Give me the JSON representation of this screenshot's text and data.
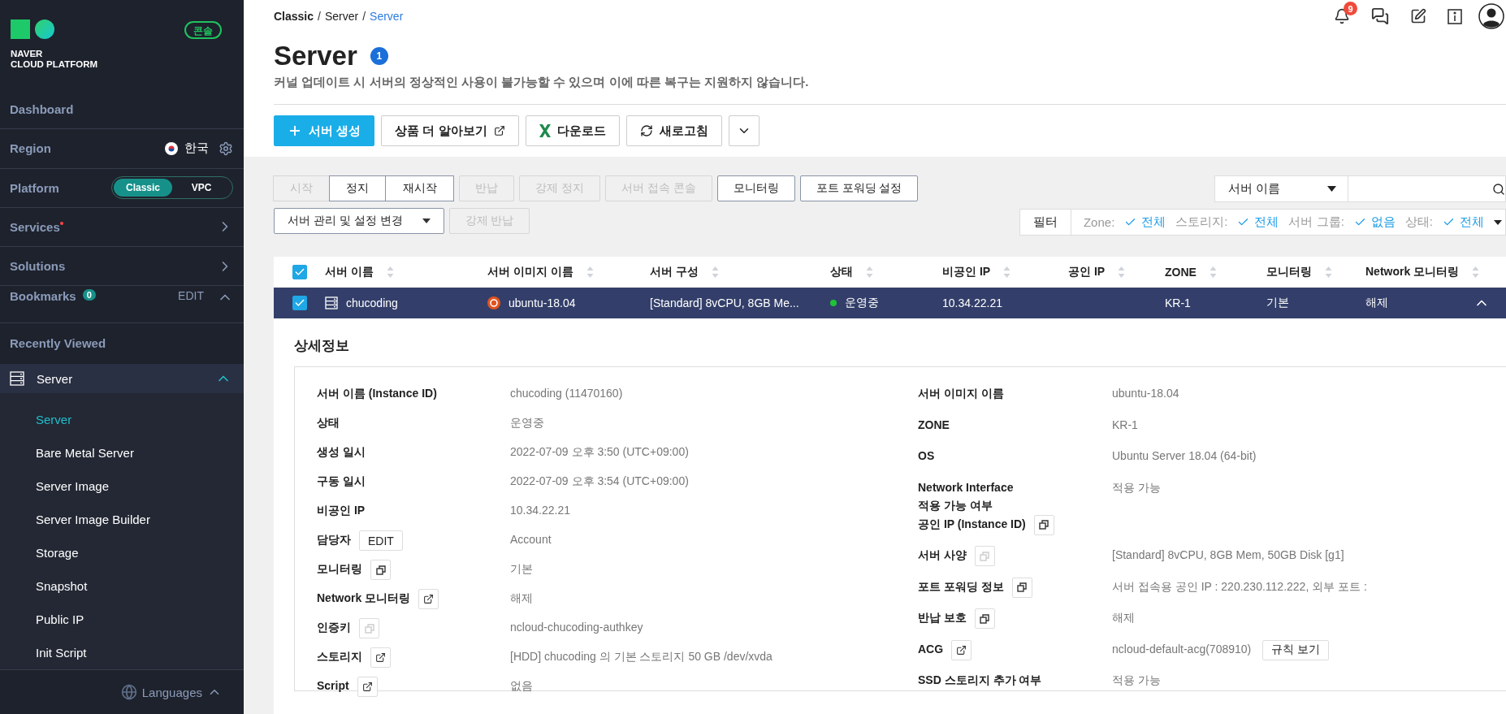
{
  "sidebar": {
    "logo": {
      "line1": "NAVER",
      "line2": "CLOUD PLATFORM"
    },
    "console_badge": "콘솔",
    "items": [
      {
        "kind": "link",
        "label": "Dashboard"
      },
      {
        "kind": "region",
        "label": "Region",
        "value": "한국"
      },
      {
        "kind": "platform",
        "label": "Platform",
        "options": [
          {
            "label": "Classic",
            "selected": true
          },
          {
            "label": "VPC",
            "selected": false
          }
        ]
      },
      {
        "kind": "nav",
        "label": "Services",
        "new": true
      },
      {
        "kind": "nav",
        "label": "Solutions",
        "new": false
      },
      {
        "kind": "bookmarks",
        "label": "Bookmarks",
        "count": "0",
        "action": "EDIT",
        "expanded": true
      },
      {
        "kind": "heading",
        "label": "Recently Viewed"
      }
    ],
    "recent": {
      "label": "Server",
      "expanded": true,
      "children": [
        {
          "label": "Server",
          "selected": true
        },
        {
          "label": "Bare Metal Server",
          "selected": false
        },
        {
          "label": "Server Image",
          "selected": false
        },
        {
          "label": "Server Image Builder",
          "selected": false
        },
        {
          "label": "Storage",
          "selected": false
        },
        {
          "label": "Snapshot",
          "selected": false
        },
        {
          "label": "Public IP",
          "selected": false
        },
        {
          "label": "Init Script",
          "selected": false
        }
      ]
    },
    "languages": "Languages"
  },
  "header": {
    "breadcrumb": [
      {
        "label": "Classic",
        "current": false,
        "separator": "/"
      },
      {
        "label": "Server",
        "current": false,
        "separator": "/"
      },
      {
        "label": "Server",
        "current": true
      }
    ],
    "notification_count": "9"
  },
  "page": {
    "title": "Server",
    "count": "1",
    "notice": "커널 업데이트 시 서버의 정상적인 사용이 불가능할 수 있으며 이에 따른 복구는 지원하지 않습니다."
  },
  "top_buttons": [
    {
      "kind": "primary",
      "label": "서버 생성"
    },
    {
      "kind": "external",
      "label": "상품 더 알아보기"
    },
    {
      "kind": "excel",
      "label": "다운로드"
    },
    {
      "kind": "refresh",
      "label": "새로고침"
    },
    {
      "kind": "more"
    }
  ],
  "actions": [
    [
      {
        "label": "시작",
        "disabled": true,
        "kind": "group"
      },
      {
        "label": "정지",
        "disabled": false,
        "kind": "group"
      },
      {
        "label": "재시작",
        "disabled": false,
        "kind": "group"
      },
      {
        "label": "반납",
        "disabled": true,
        "kind": "single"
      },
      {
        "label": "강제 정지",
        "disabled": true,
        "kind": "single"
      },
      {
        "label": "서버 접속 콘솔",
        "disabled": true,
        "kind": "single"
      },
      {
        "label": "모니터링",
        "disabled": false,
        "kind": "single"
      },
      {
        "label": "포트 포워딩 설정",
        "disabled": false,
        "kind": "single"
      }
    ],
    [
      {
        "label": "서버 관리 및 설정 변경",
        "disabled": false,
        "kind": "dropdown"
      },
      {
        "label": "강제 반납",
        "disabled": true,
        "kind": "single"
      }
    ]
  ],
  "search": {
    "field": "서버 이름"
  },
  "filter": {
    "label": "필터",
    "items": [
      {
        "name": "Zone:",
        "value": "전체"
      },
      {
        "name": "스토리지:",
        "value": "전체"
      },
      {
        "name": "서버 그룹:",
        "value": "없음"
      },
      {
        "name": "상태:",
        "value": "전체"
      }
    ]
  },
  "table": {
    "all_checked": true,
    "columns": [
      "서버 이름",
      "서버 이미지 이름",
      "서버 구성",
      "상태",
      "비공인 IP",
      "공인 IP",
      "ZONE",
      "모니터링",
      "Network 모니터링"
    ],
    "rows": [
      {
        "selected": true,
        "checked": true,
        "expanded": true,
        "name": "chucoding",
        "image": "ubuntu-18.04",
        "spec": "[Standard] 8vCPU, 8GB Me...",
        "status": "운영중",
        "color": "#1ec337",
        "private_ip": "10.34.22.21",
        "zone": "KR-1",
        "monitoring": "기본",
        "network_monitoring": "해제"
      }
    ]
  },
  "details": {
    "title": "상세정보",
    "left": [
      {
        "label": "서버 이름 (Instance ID)",
        "value": "chucoding (11470160)"
      },
      {
        "label": "상태",
        "value": "운영중"
      },
      {
        "label": "생성 일시",
        "value": "2022-07-09 오후 3:50 (UTC+09:00)"
      },
      {
        "label": "구동 일시",
        "value": "2022-07-09 오후 3:54 (UTC+09:00)"
      },
      {
        "label": "비공인 IP",
        "value": "10.34.22.21"
      },
      {
        "label": "담당자",
        "button": "EDIT",
        "value": "Account"
      },
      {
        "label": "모니터링",
        "kind": "copy",
        "icon_disabled": false,
        "value": "기본"
      },
      {
        "label": "Network 모니터링",
        "kind": "external",
        "icon_disabled": false,
        "value": "해제"
      },
      {
        "label": "인증키",
        "kind": "copy",
        "icon_disabled": true,
        "value": "ncloud-chucoding-authkey"
      },
      {
        "label": "스토리지",
        "kind": "external",
        "icon_disabled": false,
        "value": "[HDD] chucoding 의 기본 스토리지  50 GB /dev/xvda"
      },
      {
        "label": "Script",
        "kind": "external",
        "icon_disabled": false,
        "value": "없음"
      }
    ],
    "right": [
      {
        "label": "서버 이미지 이름",
        "value": "ubuntu-18.04"
      },
      {
        "label": "ZONE",
        "value": "KR-1"
      },
      {
        "label": "OS",
        "value": "Ubuntu Server 18.04 (64-bit)"
      },
      {
        "label": "Network Interface\n적용 가능 여부",
        "value": "적용 가능"
      },
      {
        "label": "공인 IP (Instance ID)",
        "kind": "copy",
        "icon_disabled": false
      },
      {
        "label": "서버 사양",
        "kind": "copy",
        "icon_disabled": true,
        "value": "[Standard] 8vCPU, 8GB Mem, 50GB Disk [g1]"
      },
      {
        "label": "포트 포워딩 정보",
        "kind": "copy",
        "icon_disabled": false,
        "value": "서버 접속용 공인 IP : 220.230.112.222, 외부 포트 :"
      },
      {
        "label": "반납 보호",
        "kind": "copy",
        "icon_disabled": false,
        "value": "해제"
      },
      {
        "label": "ACG",
        "kind": "external",
        "icon_disabled": false,
        "value": "ncloud-default-acg(708910)",
        "value_button": "규칙 보기"
      },
      {
        "label": "SSD 스토리지 추가 여부",
        "value": "적용 가능"
      }
    ]
  }
}
